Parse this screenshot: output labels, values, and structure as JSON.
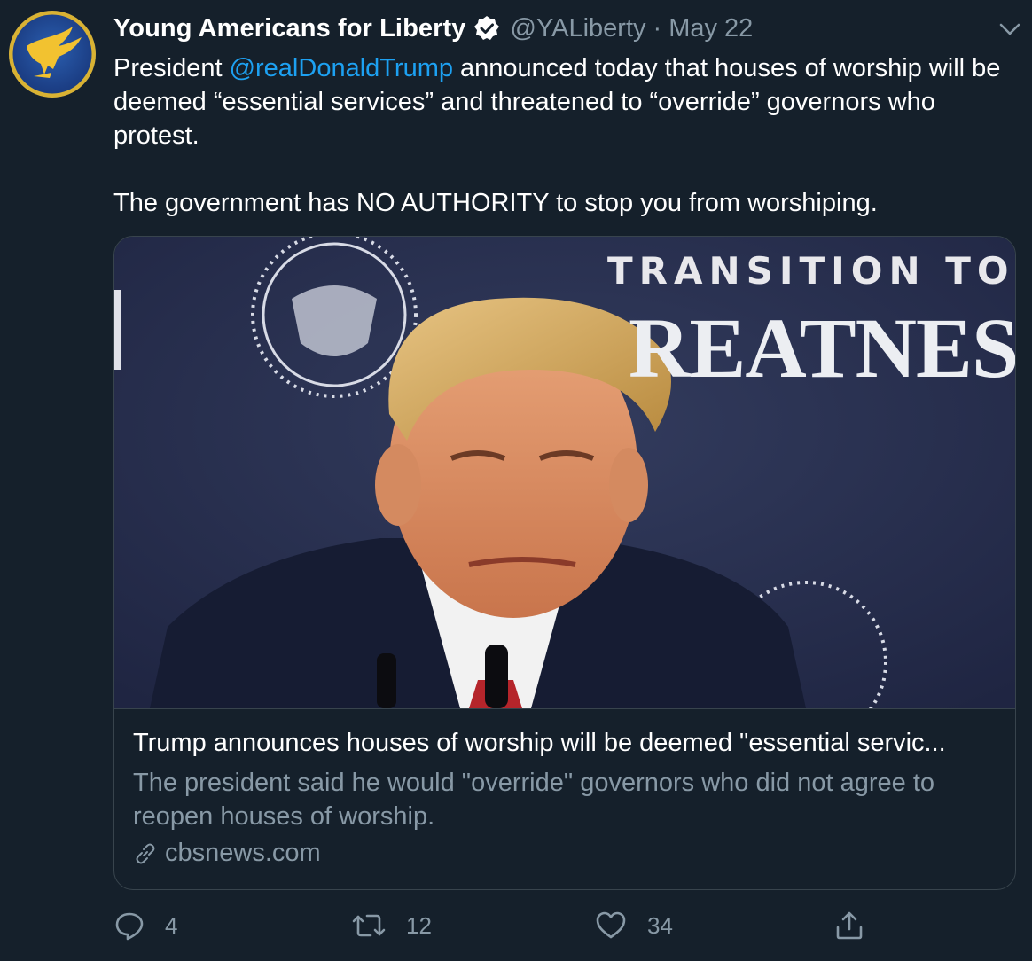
{
  "author": {
    "name": "Young Americans for Liberty",
    "handle": "@YALiberty",
    "separator": "·",
    "date": "May 22",
    "verified": true
  },
  "tweet": {
    "text_pre": "President ",
    "mention": "@realDonaldTrump",
    "text_post": " announced today that houses of worship will be deemed “essential services” and threatened to “override” governors who protest.",
    "text_p2": "The government has NO AUTHORITY to stop you from worshiping."
  },
  "card": {
    "image_text_line1": "TRANSITION TO",
    "image_text_line2": "REATNESS",
    "title": "Trump announces houses of worship will be deemed \"essential servic...",
    "description": "The president said he would \"override\" governors who did not agree to reopen houses of worship.",
    "domain": "cbsnews.com"
  },
  "actions": {
    "replies": "4",
    "retweets": "12",
    "likes": "34"
  },
  "colors": {
    "background": "#15202b",
    "accent": "#1da1f2",
    "secondary_text": "#8899a6",
    "border": "#38444d"
  },
  "icons": [
    "verified-badge-icon",
    "chevron-down-icon",
    "link-icon",
    "reply-icon",
    "retweet-icon",
    "like-icon",
    "share-icon"
  ]
}
